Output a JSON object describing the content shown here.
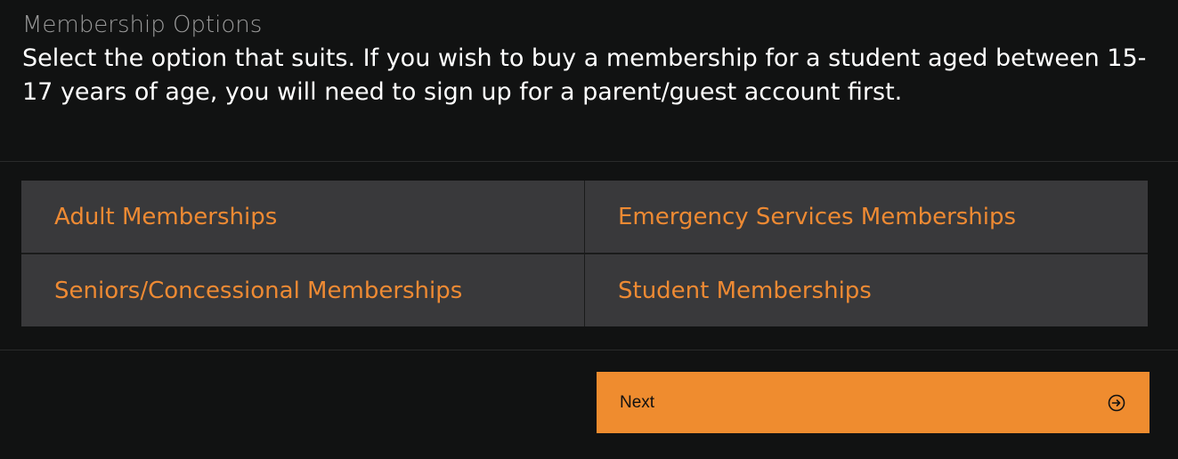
{
  "section": {
    "title": "Membership Options",
    "intro": "Select the option that suits. If you wish to buy a membership for a student aged between 15-17 years of age, you will need to sign up for a parent/guest account first."
  },
  "options": [
    {
      "label": "Adult Memberships"
    },
    {
      "label": "Emergency Services Memberships"
    },
    {
      "label": "Seniors/Concessional Memberships"
    },
    {
      "label": "Student Memberships"
    }
  ],
  "actions": {
    "next_label": "Next",
    "next_icon": "arrow-circle-right-icon"
  },
  "colors": {
    "accent": "#ef8c2f",
    "option_text": "#ee8a33",
    "option_bg": "#39393b",
    "page_bg": "#111212"
  }
}
